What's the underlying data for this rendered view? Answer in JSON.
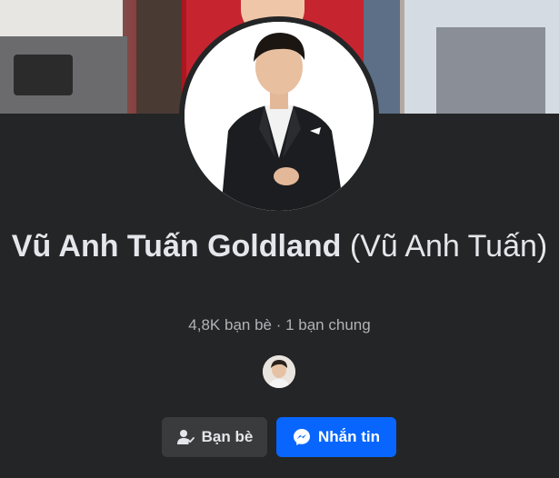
{
  "profile": {
    "name": "Vũ Anh Tuấn Goldland",
    "alternate_name": "(Vũ Anh Tuấn)",
    "friends_summary": "4,8K bạn bè · 1 bạn chung"
  },
  "actions": {
    "friends_label": "Bạn bè",
    "message_label": "Nhắn tin"
  },
  "icons": {
    "friends": "friend-check-icon",
    "message": "messenger-icon"
  },
  "colors": {
    "background": "#242526",
    "primary": "#0866ff",
    "secondary_button": "#3a3b3c",
    "muted_text": "#b0b3b8"
  }
}
